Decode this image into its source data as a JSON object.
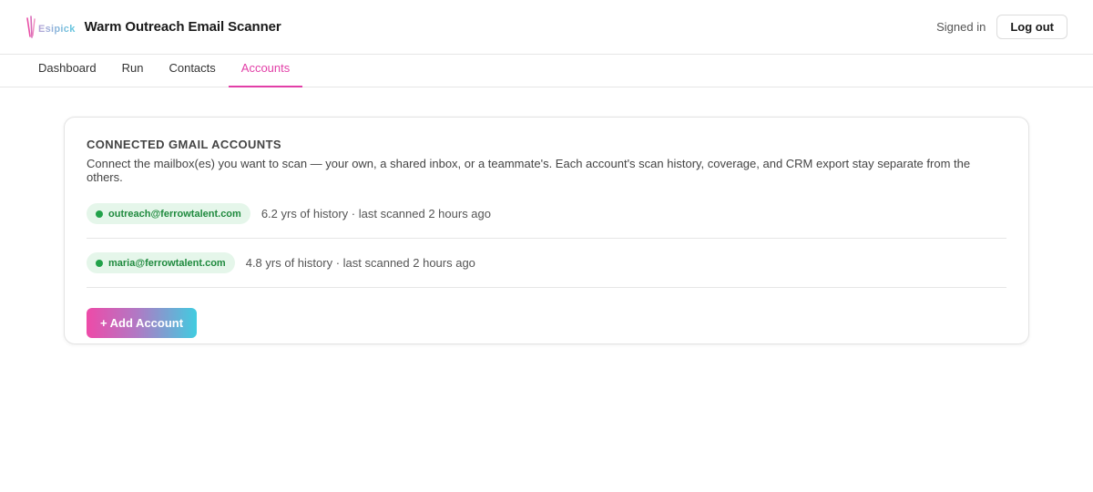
{
  "header": {
    "logo_text": "Esipick",
    "app_title": "Warm Outreach Email Scanner",
    "signed_in_label": "Signed in",
    "logout_label": "Log out"
  },
  "tabs": [
    {
      "label": "Dashboard",
      "active": false
    },
    {
      "label": "Run",
      "active": false
    },
    {
      "label": "Contacts",
      "active": false
    },
    {
      "label": "Accounts",
      "active": true
    }
  ],
  "card": {
    "title": "CONNECTED GMAIL ACCOUNTS",
    "description": "Connect the mailbox(es) you want to scan — your own, a shared inbox, or a teammate's. Each account's scan history, coverage, and CRM export stay separate from the others.",
    "accounts": [
      {
        "email": "outreach@ferrowtalent.com",
        "meta": "6.2 yrs of history · last scanned 2 hours ago",
        "status": "connected"
      },
      {
        "email": "maria@ferrowtalent.com",
        "meta": "4.8 yrs of history · last scanned 2 hours ago",
        "status": "connected"
      }
    ],
    "add_button_label": "+ Add Account"
  },
  "colors": {
    "accent": "#e23fa7",
    "status_green": "#22a24a",
    "badge_bg": "#e5f6ea",
    "gradient_start": "#ee4aa8",
    "gradient_end": "#41cce0"
  },
  "icons": {
    "logo": "esipick-logo-icon",
    "status": "status-dot-icon"
  }
}
